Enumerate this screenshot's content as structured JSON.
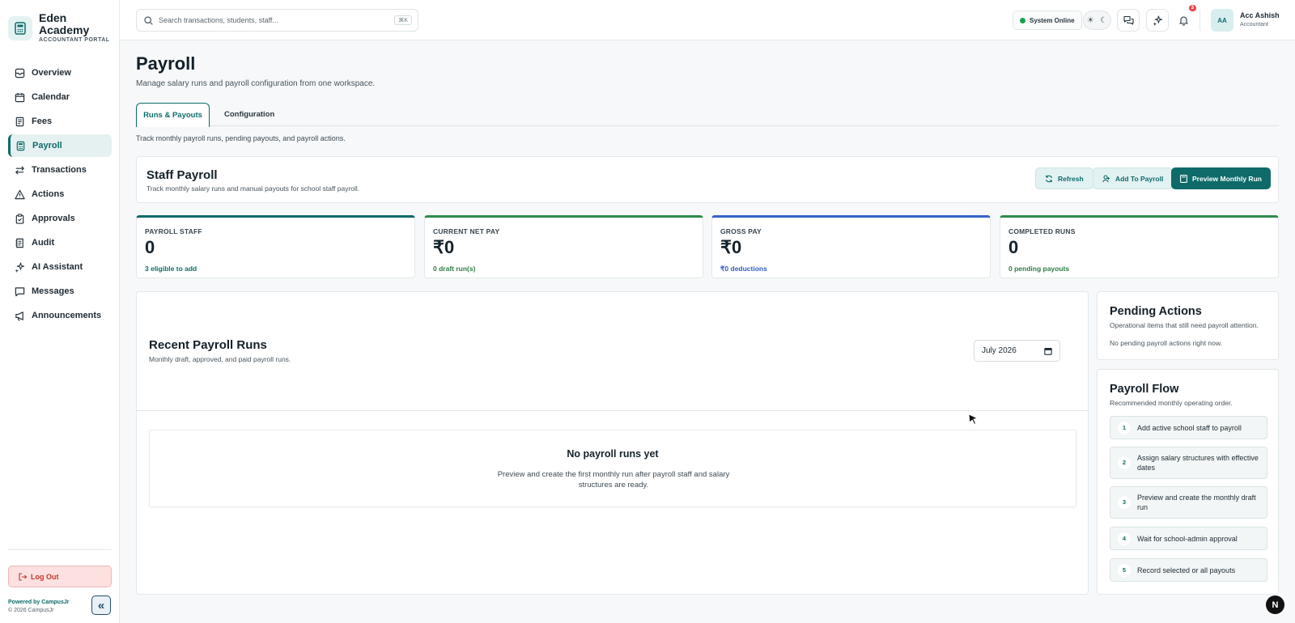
{
  "brand": {
    "name": "Eden Academy",
    "subtitle": "ACCOUNTANT PORTAL"
  },
  "sidebar": {
    "items": [
      {
        "label": "Overview",
        "icon": "overview-icon"
      },
      {
        "label": "Calendar",
        "icon": "calendar-icon"
      },
      {
        "label": "Fees",
        "icon": "fees-icon"
      },
      {
        "label": "Payroll",
        "icon": "payroll-icon",
        "active": true
      },
      {
        "label": "Transactions",
        "icon": "transactions-icon"
      },
      {
        "label": "Actions",
        "icon": "warning-icon"
      },
      {
        "label": "Approvals",
        "icon": "clipboard-icon"
      },
      {
        "label": "Audit",
        "icon": "audit-icon"
      },
      {
        "label": "AI Assistant",
        "icon": "sparkles-icon"
      },
      {
        "label": "Messages",
        "icon": "message-icon"
      },
      {
        "label": "Announcements",
        "icon": "megaphone-icon"
      }
    ],
    "logout_label": "Log Out",
    "powered_by": "Powered by CampusJr",
    "copyright": "© 2026 CampusJr"
  },
  "topbar": {
    "search_placeholder": "Search transactions, students, staff...",
    "shortcut": "⌘K",
    "status": "System Online",
    "notification_count": "3",
    "user": {
      "initials": "AA",
      "name": "Acc Ashish",
      "role": "Accountant"
    }
  },
  "page": {
    "title": "Payroll",
    "subtitle": "Manage salary runs and payroll configuration from one workspace.",
    "tabs": [
      {
        "label": "Runs & Payouts",
        "active": true
      },
      {
        "label": "Configuration"
      }
    ],
    "tab_description": "Track monthly payroll runs, pending payouts, and payroll actions."
  },
  "staff_payroll": {
    "title": "Staff Payroll",
    "description": "Track monthly salary runs and manual payouts for school staff payroll.",
    "buttons": {
      "refresh": "Refresh",
      "add": "Add To Payroll",
      "preview": "Preview Monthly Run"
    }
  },
  "stats": [
    {
      "label": "PAYROLL STAFF",
      "value": "0",
      "note": "3 eligible to add",
      "color": "#0e6b69"
    },
    {
      "label": "CURRENT NET PAY",
      "value": "₹0",
      "note": "0 draft run(s)",
      "color": "#2e8b4e"
    },
    {
      "label": "GROSS PAY",
      "value": "₹0",
      "note": "₹0 deductions",
      "color": "#3563c9"
    },
    {
      "label": "COMPLETED RUNS",
      "value": "0",
      "note": "0 pending payouts",
      "color": "#2e8b4e"
    }
  ],
  "recent_runs": {
    "title": "Recent Payroll Runs",
    "description": "Monthly draft, approved, and paid payroll runs.",
    "month": "July 2026",
    "empty_title": "No payroll runs yet",
    "empty_description": "Preview and create the first monthly run after payroll staff and salary structures are ready."
  },
  "pending_actions": {
    "title": "Pending Actions",
    "description": "Operational items that still need payroll attention.",
    "empty": "No pending payroll actions right now."
  },
  "payroll_flow": {
    "title": "Payroll Flow",
    "description": "Recommended monthly operating order.",
    "steps": [
      {
        "num": "1",
        "text": "Add active school staff to payroll"
      },
      {
        "num": "2",
        "text": "Assign salary structures with effective dates"
      },
      {
        "num": "3",
        "text": "Preview and create the monthly draft run"
      },
      {
        "num": "4",
        "text": "Wait for school-admin approval"
      },
      {
        "num": "5",
        "text": "Record selected or all payouts"
      }
    ]
  },
  "corner_badge": "N"
}
